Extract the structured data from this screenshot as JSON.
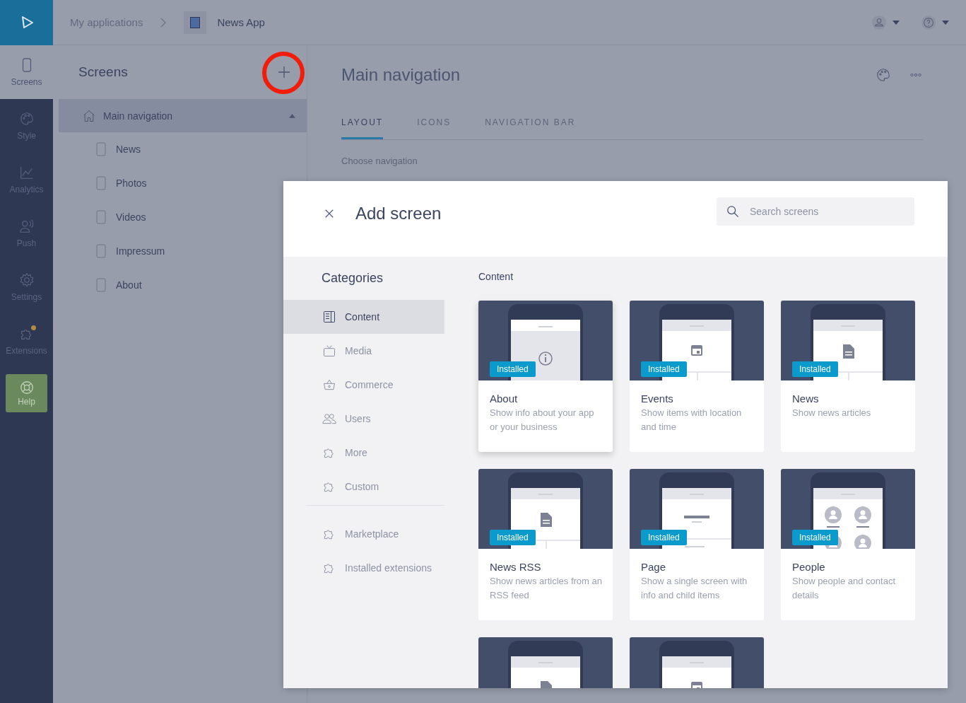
{
  "rail": {
    "items": [
      {
        "label": "Screens",
        "kind": "phone",
        "selected": true
      },
      {
        "label": "Style",
        "kind": "palette",
        "selected": false
      },
      {
        "label": "Analytics",
        "kind": "chart",
        "selected": false
      },
      {
        "label": "Push",
        "kind": "push",
        "selected": false
      },
      {
        "label": "Settings",
        "kind": "gear",
        "selected": false
      },
      {
        "label": "Extensions",
        "kind": "puzzle",
        "selected": false,
        "notification": true
      }
    ],
    "help": "Help"
  },
  "breadcrumb": {
    "root": "My applications",
    "app": "News App"
  },
  "sidebar": {
    "title": "Screens",
    "add_highlighted": true,
    "root": {
      "label": "Main navigation",
      "expanded": true,
      "children": [
        {
          "label": "News"
        },
        {
          "label": "Photos"
        },
        {
          "label": "Videos"
        },
        {
          "label": "Impressum"
        },
        {
          "label": "About"
        }
      ]
    }
  },
  "main": {
    "title": "Main navigation",
    "tabs": [
      {
        "label": "LAYOUT",
        "selected": true
      },
      {
        "label": "ICONS",
        "selected": false
      },
      {
        "label": "NAVIGATION BAR",
        "selected": false
      }
    ],
    "section": "Choose navigation"
  },
  "dialog": {
    "title": "Add screen",
    "search": {
      "placeholder": "Search screens"
    },
    "categories_title": "Categories",
    "categories": [
      {
        "label": "Content",
        "kind": "content",
        "selected": true
      },
      {
        "label": "Media",
        "kind": "media",
        "selected": false
      },
      {
        "label": "Commerce",
        "kind": "basket",
        "selected": false
      },
      {
        "label": "Users",
        "kind": "users",
        "selected": false
      },
      {
        "label": "More",
        "kind": "puzzle",
        "selected": false
      },
      {
        "label": "Custom",
        "kind": "puzzle",
        "selected": false
      }
    ],
    "extra_categories": [
      {
        "label": "Marketplace",
        "kind": "puzzle"
      },
      {
        "label": "Installed extensions",
        "kind": "puzzle"
      }
    ],
    "section": "Content",
    "cards": [
      {
        "kind": "info",
        "title": "About",
        "description": "Show info about your app or your business",
        "badge": "Installed",
        "hovered": true
      },
      {
        "kind": "calendar",
        "title": "Events",
        "description": "Show items with location and time",
        "badge": "Installed",
        "hovered": false
      },
      {
        "kind": "document",
        "title": "News",
        "description": "Show news articles",
        "badge": "Installed",
        "hovered": false
      },
      {
        "kind": "document",
        "title": "News RSS",
        "description": "Show news articles from an RSS feed",
        "badge": "Installed",
        "hovered": false
      },
      {
        "kind": "text",
        "title": "Page",
        "description": "Show a single screen with info and child items",
        "badge": "Installed",
        "hovered": false
      },
      {
        "kind": "people",
        "title": "People",
        "description": "Show people and contact details",
        "badge": "Installed",
        "hovered": false
      },
      {
        "kind": "document",
        "hovered": false
      },
      {
        "kind": "calendar",
        "hovered": false
      }
    ]
  }
}
